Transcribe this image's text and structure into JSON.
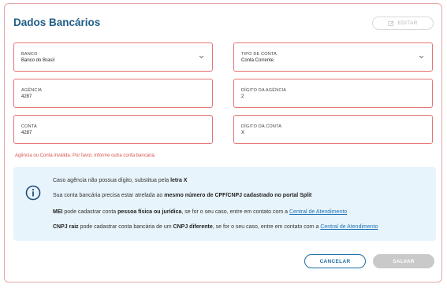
{
  "header": {
    "title": "Dados Bancários",
    "edit_label": "EDITAR"
  },
  "fields": {
    "banco": {
      "label": "BANCO",
      "value": "Banco do Brasil"
    },
    "tipo_conta": {
      "label": "TIPO DE CONTA",
      "value": "Conta Corrente"
    },
    "agencia": {
      "label": "AGÊNCIA",
      "value": "4287"
    },
    "digito_agencia": {
      "label": "DÍGITO DA AGÊNCIA",
      "value": "2"
    },
    "conta": {
      "label": "CONTA",
      "value": "4287"
    },
    "digito_conta": {
      "label": "DÍGITO DA CONTA",
      "value": "X"
    }
  },
  "error": "Agência ou Conta inválida. Por favor, informe outra conta bancária.",
  "info": {
    "line1_pre": "Caso agência não possua dígito, substitua pela ",
    "line1_bold": "letra X",
    "line2_pre": "Sua conta bancária precisa estar atrelada ao ",
    "line2_bold": "mesmo número de CPF/CNPJ cadastrado no portal Split",
    "line3_bold1": "MEI",
    "line3_mid1": " pode cadastrar conta ",
    "line3_bold2": "pessoa física ou jurídica",
    "line3_mid2": ", se for o seu caso, entre em contato com a ",
    "line3_link": "Central de Atendimento",
    "line4_bold1": "CNPJ raiz",
    "line4_mid1": " pode cadastrar conta bancária de um ",
    "line4_bold2": "CNPJ diferente",
    "line4_mid2": ", se for o seu caso, entre em contato com a ",
    "line4_link": "Central de Atendimento"
  },
  "actions": {
    "cancel_label": "CANCELAR",
    "save_label": "SALVAR"
  },
  "colors": {
    "accent": "#1e6fa8",
    "error": "#e57373",
    "info_bg": "#e8f4fb",
    "title": "#1f5d86"
  }
}
